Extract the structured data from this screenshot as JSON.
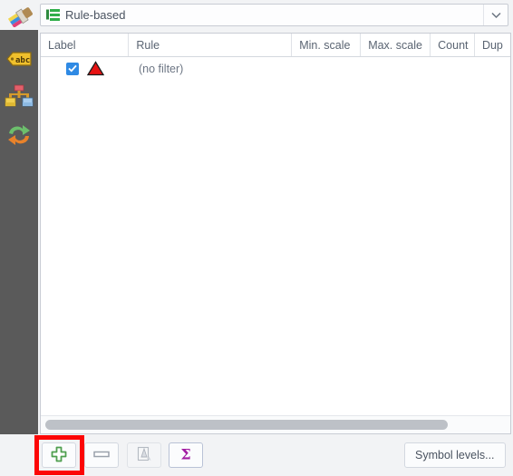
{
  "top_bar": {
    "brush_icon": "paintbrush-icon",
    "renderer": {
      "icon": "rule-based-renderer-icon",
      "value": "Rule-based",
      "arrow_icon": "chevron-down-icon"
    }
  },
  "sidebar": {
    "items": [
      {
        "name": "labels",
        "icon": "abc-label-icon"
      },
      {
        "name": "symbology",
        "icon": "symbology-brushes-icon"
      },
      {
        "name": "rendering",
        "icon": "green-orange-arrows-icon"
      }
    ]
  },
  "rules_table": {
    "columns": [
      {
        "key": "label",
        "header": "Label"
      },
      {
        "key": "rule",
        "header": "Rule"
      },
      {
        "key": "min_scale",
        "header": "Min. scale"
      },
      {
        "key": "max_scale",
        "header": "Max. scale"
      },
      {
        "key": "count",
        "header": "Count"
      },
      {
        "key": "duplicate",
        "header": "Dup"
      }
    ],
    "rows": [
      {
        "checked": true,
        "label": "",
        "symbol": "red-triangle-marker",
        "rule": "(no filter)",
        "min_scale": "",
        "max_scale": "",
        "count": "",
        "duplicate": ""
      }
    ],
    "hscrollbar": "horizontal-scrollbar"
  },
  "bottom_bar": {
    "add_label": "",
    "add_icon": "green-plus-icon",
    "remove_label": "",
    "remove_icon": "minus-icon",
    "edit_label": "",
    "edit_icon": "edit-rule-icon",
    "count_label": "",
    "count_icon": "sigma-icon",
    "symbol_levels_label": "Symbol levels..."
  },
  "annotation": {
    "highlight_color": "#fc0606",
    "highlight_target": "add-rule-button"
  },
  "colors": {
    "sidebar_bg": "#5a5a5a",
    "panel_bg": "#ffffff",
    "window_bg": "#f2f3f5",
    "checkbox_blue": "#2f8ae4",
    "symbol_red": "#e81313",
    "sigma_purple": "#a21ca2",
    "plus_green": "#4f9f4f"
  }
}
